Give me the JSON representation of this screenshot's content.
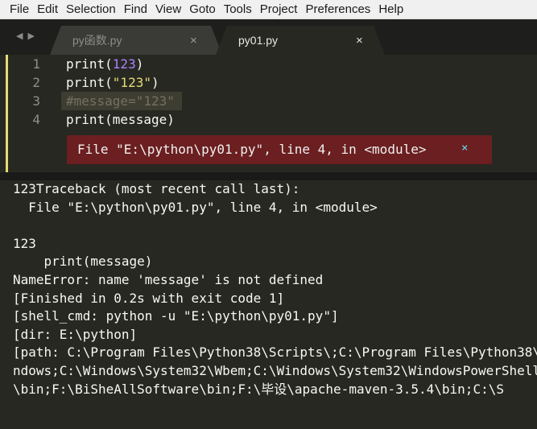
{
  "menubar": {
    "items": [
      "File",
      "Edit",
      "Selection",
      "Find",
      "View",
      "Goto",
      "Tools",
      "Project",
      "Preferences",
      "Help"
    ]
  },
  "tabs": [
    {
      "label": "py函数.py",
      "active": false
    },
    {
      "label": "py01.py",
      "active": true
    }
  ],
  "nav_arrows": {
    "left": "◀",
    "right": "▶"
  },
  "close_glyph": "×",
  "editor": {
    "lines": [
      {
        "number": "1",
        "tokens": [
          {
            "t": "print(",
            "c": "kw"
          },
          {
            "t": "123",
            "c": "num"
          },
          {
            "t": ")",
            "c": "kw"
          }
        ]
      },
      {
        "number": "2",
        "tokens": [
          {
            "t": "print(",
            "c": "kw"
          },
          {
            "t": "\"123\"",
            "c": "str"
          },
          {
            "t": ")",
            "c": "kw"
          }
        ]
      },
      {
        "number": "3",
        "tokens": [
          {
            "t": "#message=\"123\"",
            "c": "cmt"
          }
        ]
      },
      {
        "number": "4",
        "tokens": [
          {
            "t": "print(message)",
            "c": "kw"
          }
        ]
      }
    ],
    "error_message": "File \"E:\\python\\py01.py\", line 4, in <module>",
    "error_close": "×"
  },
  "output": {
    "lines": [
      "123Traceback (most recent call last):",
      "  File \"E:\\python\\py01.py\", line 4, in <module>",
      "",
      "123",
      "    print(message)",
      "NameError: name 'message' is not defined",
      "[Finished in 0.2s with exit code 1]",
      "[shell_cmd: python -u \"E:\\python\\py01.py\"]",
      "[dir: E:\\python]",
      "[path: C:\\Program Files\\Python38\\Scripts\\;C:\\Program Files\\Python38\\",
      "ndows;C:\\Windows\\System32\\Wbem;C:\\Windows\\System32\\WindowsPowerShell",
      "\\bin;F:\\BiSheAllSoftware\\bin;F:\\毕设\\apache-maven-3.5.4\\bin;C:\\S"
    ]
  },
  "colors": {
    "editor_bg": "#272822",
    "error_bg": "#6b1f20",
    "comment": "#75715e",
    "number": "#ae81ff",
    "string": "#e6db74"
  }
}
